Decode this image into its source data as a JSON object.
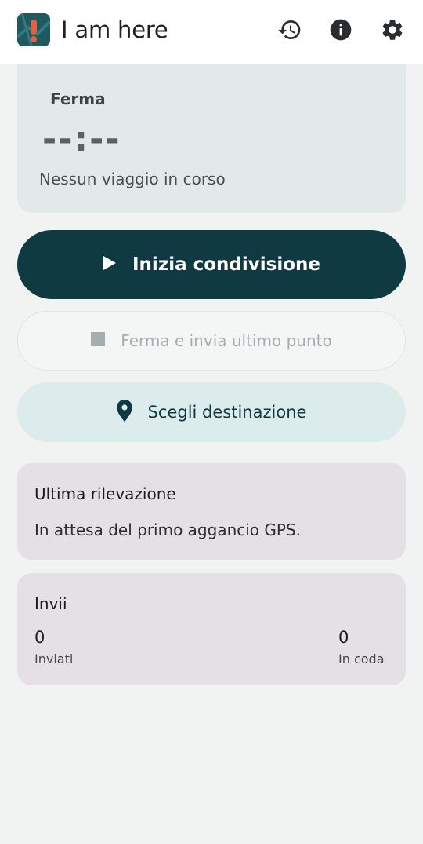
{
  "app": {
    "title": "I am here",
    "logo_icon": "app-logo-icon",
    "actions": [
      {
        "name": "history-icon"
      },
      {
        "name": "info-icon"
      },
      {
        "name": "settings-icon"
      }
    ]
  },
  "timer": {
    "state": "Ferma",
    "value": "--:--",
    "status": "Nessun viaggio in corso"
  },
  "buttons": {
    "start": {
      "label": "Inizia condivisione",
      "icon": "play-icon"
    },
    "stop": {
      "label": "Ferma e invia ultimo punto",
      "icon": "stop-icon"
    },
    "destination": {
      "label": "Scegli destinazione",
      "icon": "location-pin-icon"
    }
  },
  "last_fix": {
    "title": "Ultima rilevazione",
    "body": "In attesa del primo aggancio GPS."
  },
  "sends": {
    "title": "Invii",
    "sent_value": "0",
    "sent_label": "Inviati",
    "queued_value": "0",
    "queued_label": "In coda"
  },
  "colors": {
    "primary": "#0f3a41",
    "tonal": "#dcecec",
    "card_neutral": "#e3e8e9",
    "card_info": "#e5e0e5",
    "background": "#f1f3f3"
  }
}
